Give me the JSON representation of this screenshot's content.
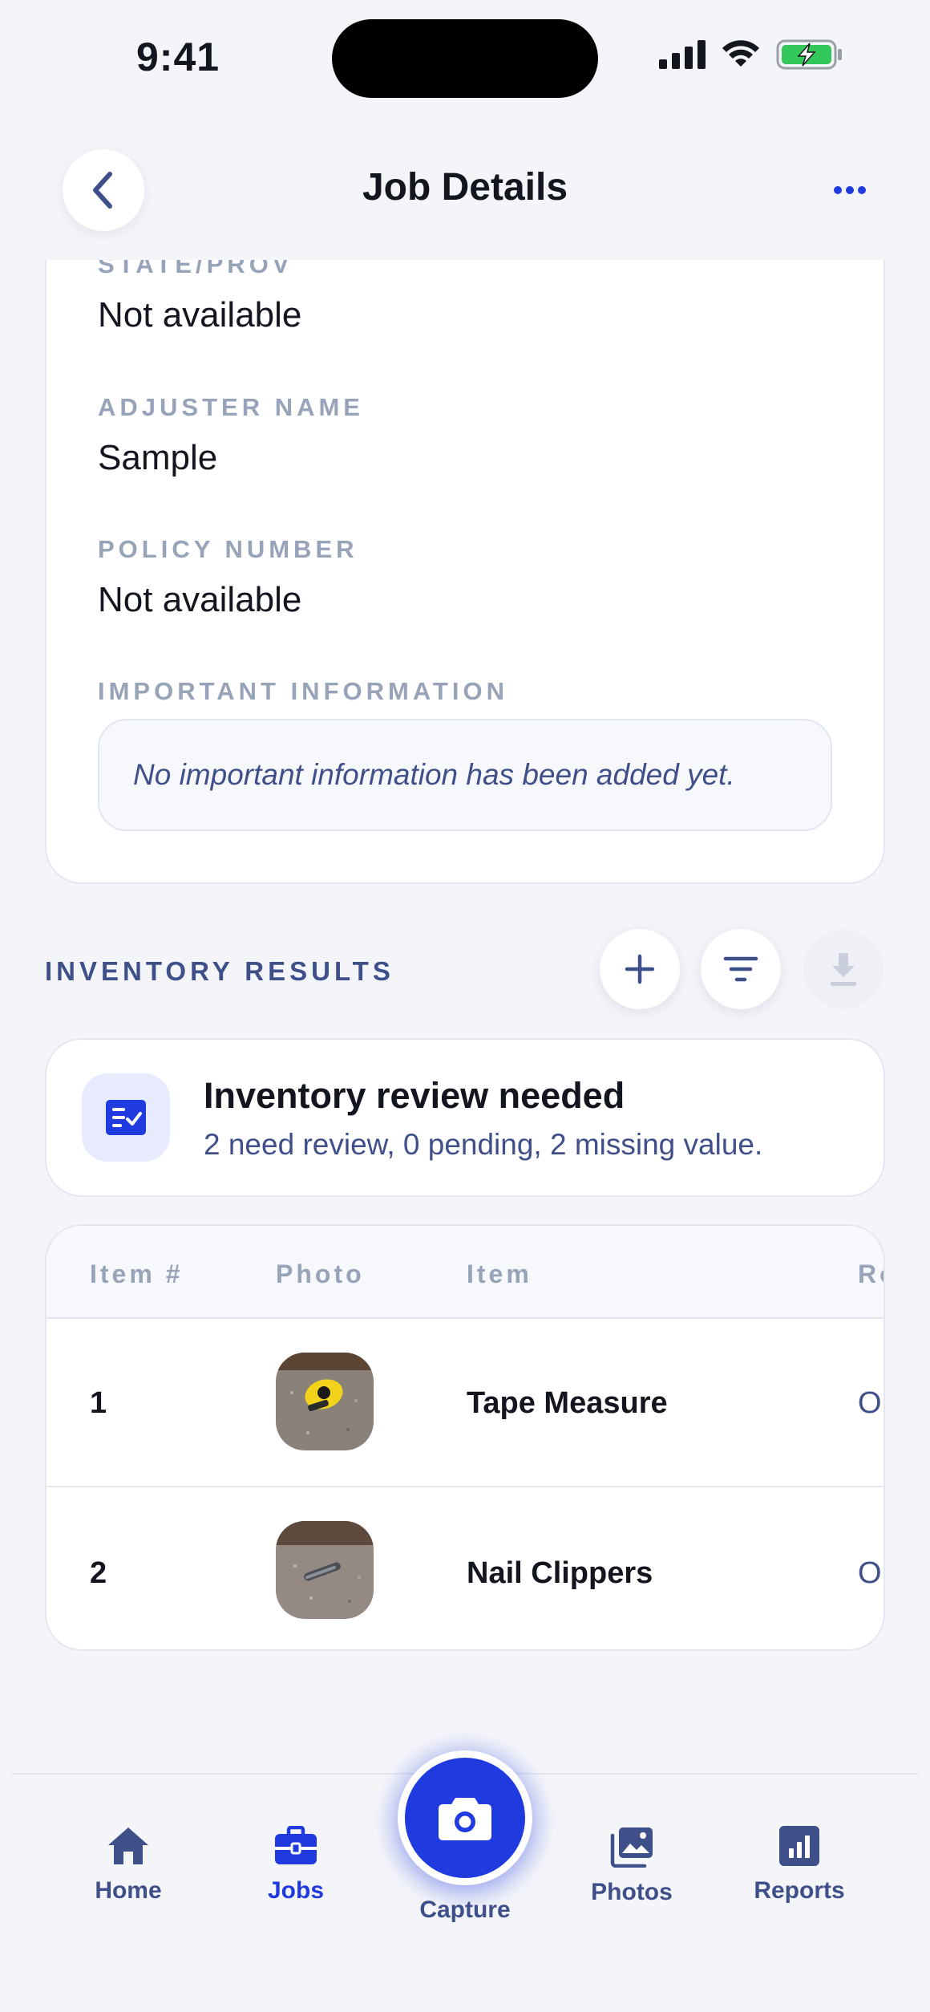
{
  "status_bar": {
    "time": "9:41"
  },
  "header": {
    "title": "Job Details"
  },
  "details": {
    "state_label": "STATE/PROV",
    "state_value": "Not available",
    "adjuster_label": "ADJUSTER NAME",
    "adjuster_value": "Sample",
    "policy_label": "POLICY NUMBER",
    "policy_value": "Not available",
    "important_label": "IMPORTANT INFORMATION",
    "important_placeholder": "No important information has been added yet."
  },
  "inventory": {
    "section_title": "INVENTORY RESULTS",
    "review": {
      "title": "Inventory review needed",
      "subtitle": "2 need review, 0 pending, 2 missing value."
    },
    "columns": [
      "Item #",
      "Photo",
      "Item",
      "Ro"
    ],
    "rows": [
      {
        "number": "1",
        "item": "Tape Measure",
        "r": "O"
      },
      {
        "number": "2",
        "item": "Nail Clippers",
        "r": "O"
      }
    ]
  },
  "tabs": {
    "home": "Home",
    "jobs": "Jobs",
    "capture": "Capture",
    "photos": "Photos",
    "reports": "Reports",
    "active": "Jobs"
  },
  "colors": {
    "accent": "#1f3be0",
    "muted_label": "#97a3b8",
    "secondary_text": "#3f4f8a",
    "background": "#f4f5f9"
  },
  "icons": {
    "back": "chevron-left-icon",
    "more": "ellipsis-icon",
    "add": "plus-icon",
    "filter": "filter-icon",
    "download": "download-icon",
    "review": "checklist-icon",
    "home": "home-icon",
    "jobs": "briefcase-icon",
    "capture": "camera-icon",
    "photos": "photos-icon",
    "reports": "bar-chart-icon"
  }
}
